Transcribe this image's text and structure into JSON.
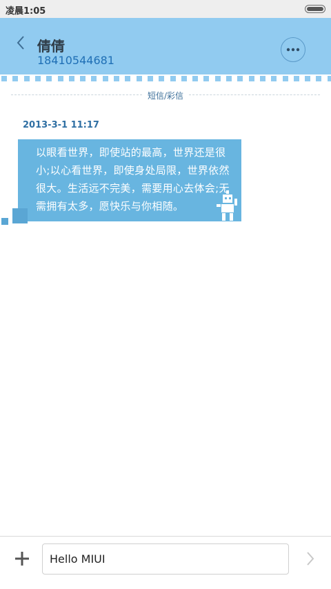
{
  "status_bar": {
    "time": "凌晨1:05",
    "battery_icon": "battery-icon"
  },
  "header": {
    "contact_name": "倩倩",
    "contact_number": "18410544681",
    "back_icon": "chevron-left-icon",
    "more_icon": "more-icon",
    "color": "#91cbf0"
  },
  "conversation": {
    "divider_label": "短信/彩信",
    "messages": [
      {
        "timestamp": "2013-3-1 11:17",
        "text": "以眼看世界，即使站的最高，世界还是很小;以心看世界，即使身处局限，世界依然很大。生活远不完美，需要用心去体会;无需拥有太多，愿快乐与你相随。"
      }
    ],
    "bubble_color": "#68b5e0"
  },
  "composer": {
    "add_icon": "plus-icon",
    "input_value": "Hello MIUI",
    "send_icon": "chevron-right-icon"
  }
}
